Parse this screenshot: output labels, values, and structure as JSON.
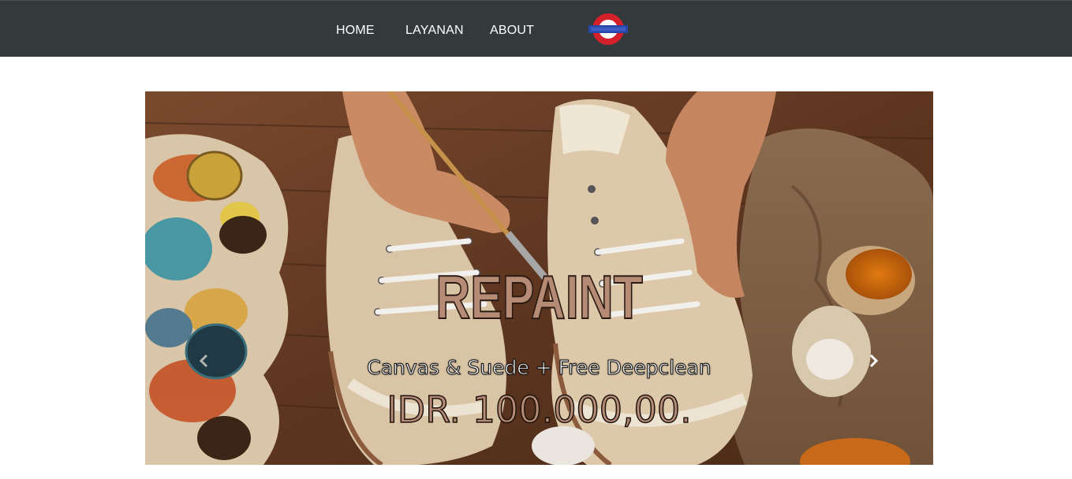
{
  "nav": {
    "items": [
      {
        "label": "HOME"
      },
      {
        "label": "LAYANAN"
      },
      {
        "label": "ABOUT"
      }
    ],
    "logo_icon": "roundel-logo-icon"
  },
  "carousel": {
    "slide": {
      "title": "REPAINT",
      "subtitle": "Canvas & Suede + Free Deepclean",
      "price": "IDR. 100.000,00."
    },
    "prev_icon": "chevron-left-icon",
    "next_icon": "chevron-right-icon"
  },
  "colors": {
    "navbar_bg": "#343a3b",
    "title_fill": "#b58b76",
    "logo_red": "#d4202a",
    "logo_blue": "#2747a8"
  }
}
